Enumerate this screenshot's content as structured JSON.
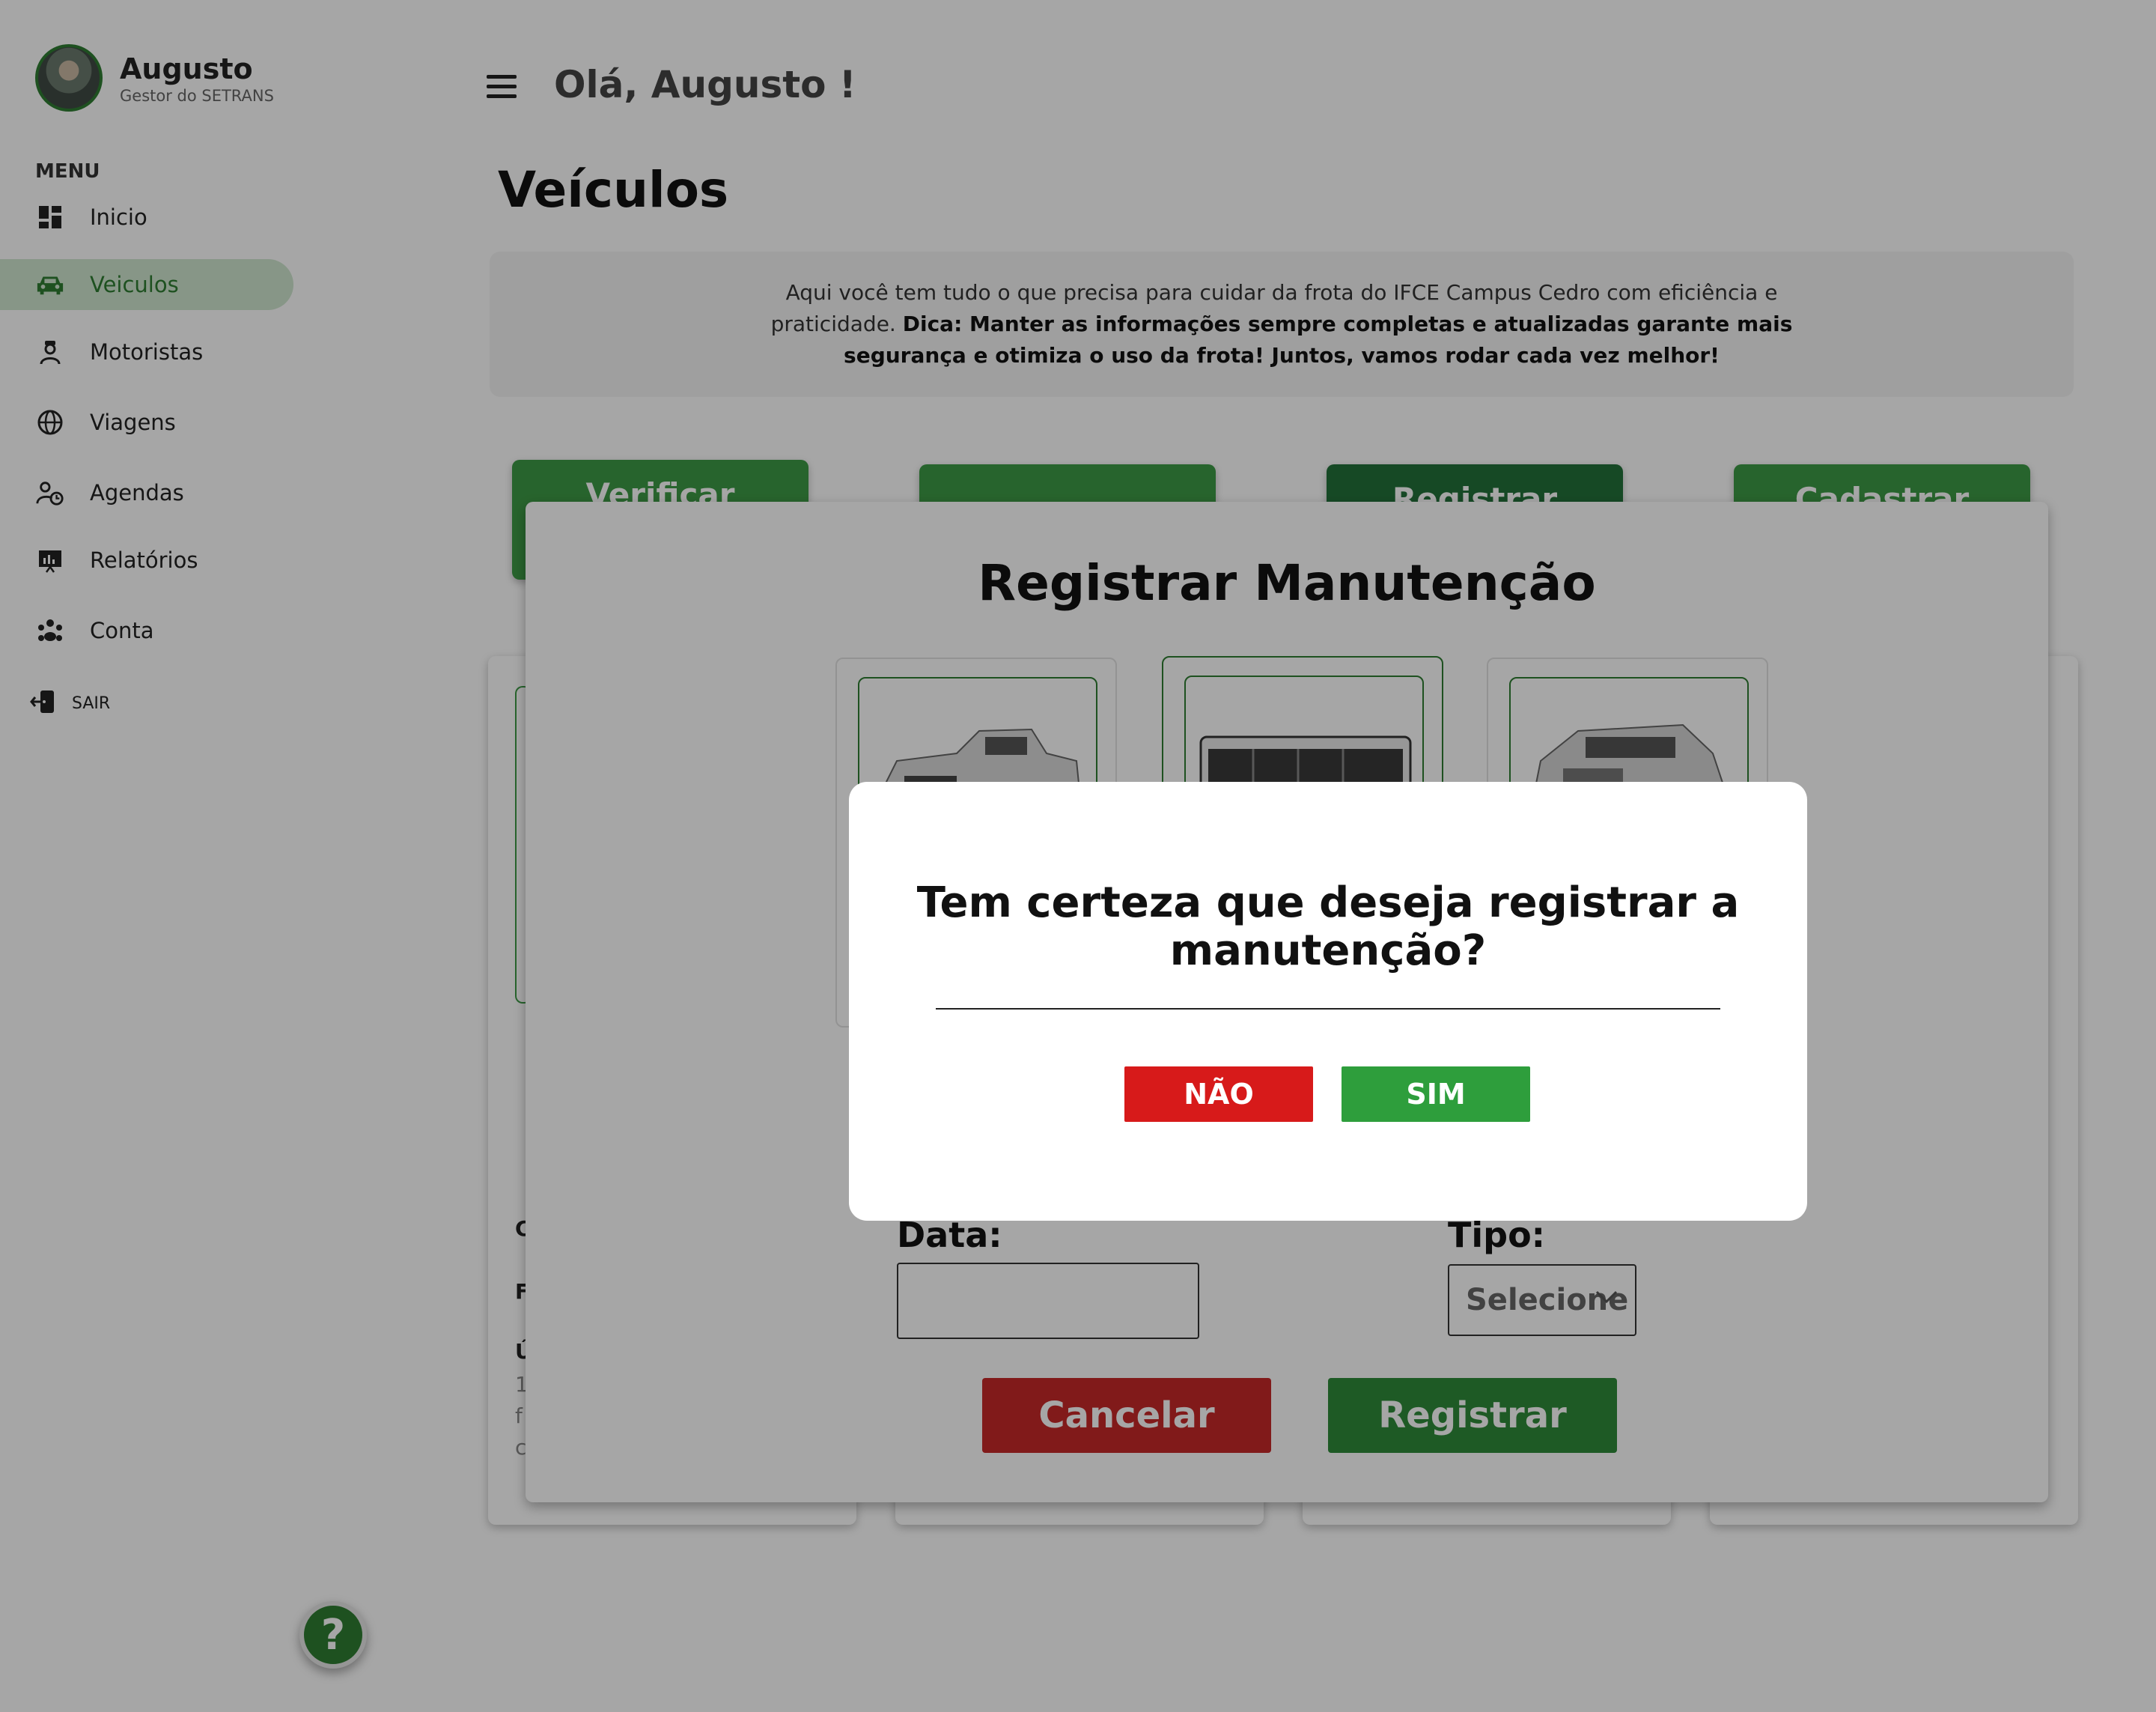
{
  "user": {
    "name": "Augusto",
    "role": "Gestor do SETRANS"
  },
  "sidebar": {
    "menu_heading": "MENU",
    "items": [
      {
        "label": "Inicio",
        "icon": "dashboard-icon",
        "active": false
      },
      {
        "label": "Veiculos",
        "icon": "car-icon",
        "active": true
      },
      {
        "label": "Motoristas",
        "icon": "driver-icon",
        "active": false
      },
      {
        "label": "Viagens",
        "icon": "globe-icon",
        "active": false
      },
      {
        "label": "Agendas",
        "icon": "schedule-icon",
        "active": false
      },
      {
        "label": "Relatórios",
        "icon": "report-icon",
        "active": false
      },
      {
        "label": "Conta",
        "icon": "account-icon",
        "active": false
      }
    ],
    "logout_label": "SAIR",
    "help_label": "?"
  },
  "header": {
    "greeting": "Olá, Augusto !"
  },
  "main": {
    "title": "Veículos",
    "info_text": "Aqui você tem tudo o que precisa para cuidar da frota do IFCE Campus Cedro com eficiência e praticidade.",
    "info_tip": "Dica: Manter as informações sempre completas e atualizadas garante mais segurança e otimiza o uso da frota! Juntos, vamos rodar cada vez melhor!",
    "actions": [
      "Verificar",
      "",
      "Registrar",
      "Cadastrar"
    ],
    "card_letters": [
      "C",
      "F",
      "Ú",
      "1",
      "f",
      "c"
    ]
  },
  "maintenance": {
    "title": "Registrar Manutenção",
    "date_label": "Data:",
    "date_value": "",
    "type_label": "Tipo:",
    "type_value": "Selecione",
    "cancel_label": "Cancelar",
    "register_label": "Registrar"
  },
  "confirm": {
    "question": "Tem certeza que deseja registrar a manutenção?",
    "no_label": "NÃO",
    "yes_label": "SIM"
  },
  "colors": {
    "brand_green": "#2e7d32",
    "danger_red": "#d71a1a",
    "success_green": "#2e9e3c"
  }
}
